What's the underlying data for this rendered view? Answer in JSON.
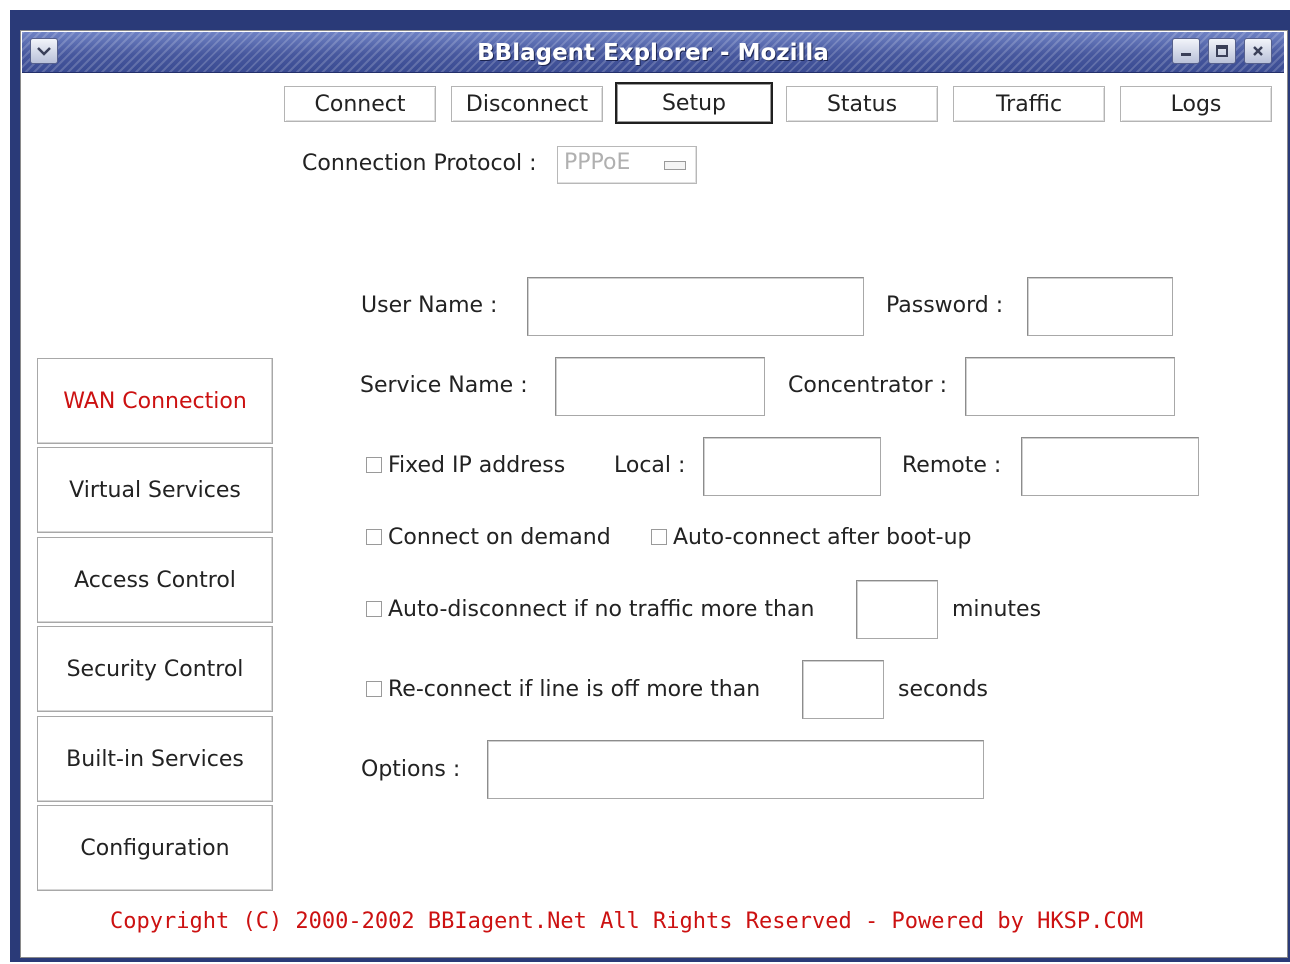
{
  "window": {
    "title": "BBlagent Explorer - Mozilla",
    "menu_icon": "chevron-down-icon",
    "controls": [
      "minimize-icon",
      "maximize-icon",
      "close-icon"
    ]
  },
  "tabs": [
    {
      "label": "Connect"
    },
    {
      "label": "Disconnect"
    },
    {
      "label": "Setup",
      "active": true
    },
    {
      "label": "Status"
    },
    {
      "label": "Traffic"
    },
    {
      "label": "Logs"
    }
  ],
  "protocol": {
    "label": "Connection Protocol :",
    "value": "PPPoE"
  },
  "sidebar": {
    "items": [
      {
        "label": "WAN Connection",
        "active": true
      },
      {
        "label": "Virtual Services"
      },
      {
        "label": "Access Control"
      },
      {
        "label": "Security Control"
      },
      {
        "label": "Built-in Services"
      },
      {
        "label": "Configuration"
      }
    ]
  },
  "form": {
    "user_name_label": "User Name :",
    "password_label": "Password :",
    "service_name_label": "Service Name :",
    "concentrator_label": "Concentrator :",
    "fixed_ip_label": "Fixed IP address",
    "local_label": "Local :",
    "remote_label": "Remote :",
    "connect_on_demand_label": "Connect on demand",
    "auto_connect_label": "Auto-connect after boot-up",
    "auto_disconnect_label": "Auto-disconnect if no traffic more than",
    "minutes_label": "minutes",
    "reconnect_label": "Re-connect if line is off more than",
    "seconds_label": "seconds",
    "options_label": "Options :"
  },
  "footer": {
    "copyright": "Copyright (C) 2000-2002 BBIagent.Net All Rights Reserved - Powered by HKSP.COM"
  },
  "colors": {
    "titlebar": "#47589e",
    "accent_red": "#cc1111",
    "outer_frame": "#2a3a78"
  }
}
